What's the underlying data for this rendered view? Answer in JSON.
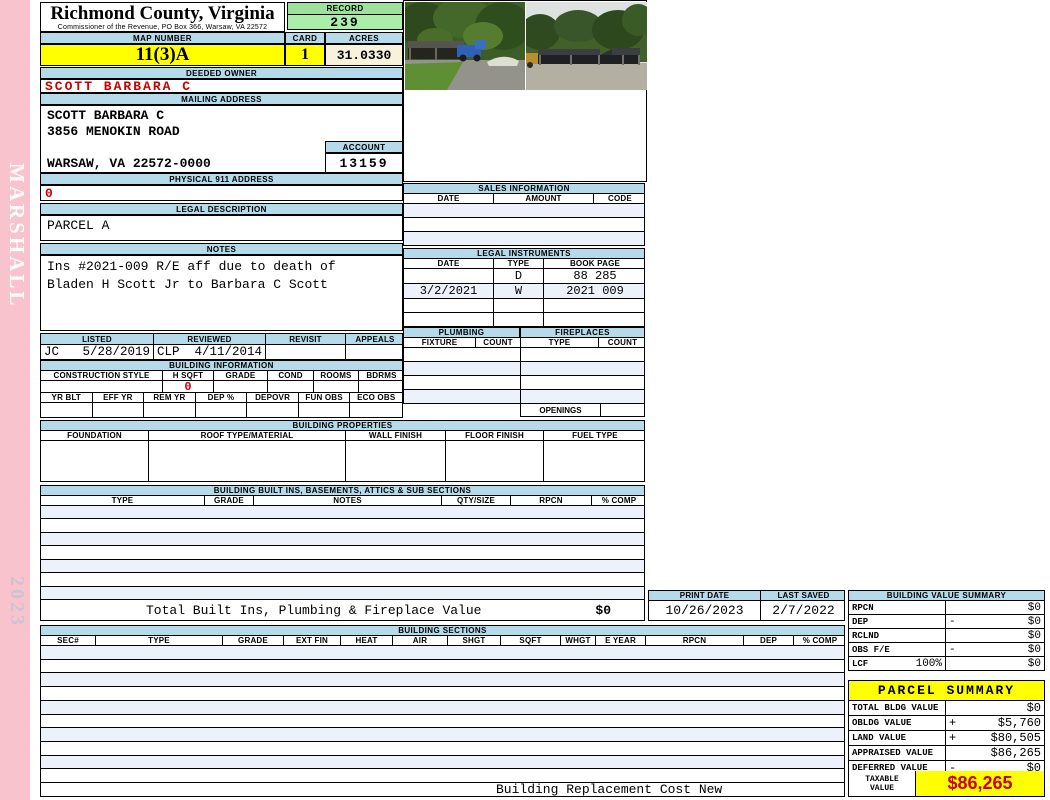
{
  "side": {
    "vendor": "MARSHALL",
    "year": "2023"
  },
  "header": {
    "county": "Richmond County, Virginia",
    "subtitle": "Commissioner of the Revenue, PO Box 366, Warsaw, VA 22572",
    "record_label": "RECORD",
    "record": "239",
    "map_number_label": "MAP NUMBER",
    "map_number": "11(3)A",
    "card_label": "CARD",
    "card": "1",
    "acres_label": "ACRES",
    "acres": "31.0330"
  },
  "owner": {
    "label": "DEEDED OWNER",
    "name": "SCOTT BARBARA C"
  },
  "mailing": {
    "label": "MAILING ADDRESS",
    "lines": [
      "SCOTT BARBARA C",
      "3856 MENOKIN ROAD",
      "",
      "WARSAW, VA 22572-0000"
    ],
    "account_label": "ACCOUNT",
    "account": "13159"
  },
  "physical911": {
    "label": "PHYSICAL 911 ADDRESS",
    "value": "0"
  },
  "legal_description": {
    "label": "LEGAL DESCRIPTION",
    "value": "PARCEL A"
  },
  "notes": {
    "label": "NOTES",
    "lines": [
      "Ins #2021-009 R/E aff due to death of",
      "Bladen H Scott Jr to Barbara C Scott"
    ]
  },
  "review": {
    "labels": [
      "LISTED",
      "REVIEWED",
      "REVISIT",
      "APPEALS"
    ],
    "listed_by": "JC",
    "listed_date": "5/28/2019",
    "reviewed_by": "CLP",
    "reviewed_date": "4/11/2014",
    "revisit": "",
    "appeals": ""
  },
  "building_information": {
    "label": "BUILDING INFORMATION",
    "headers_row1": [
      "CONSTRUCTION STYLE",
      "H SQFT",
      "GRADE",
      "COND",
      "ROOMS",
      "BDRMS"
    ],
    "h_sqft": "0",
    "headers_row2": [
      "YR BLT",
      "EFF YR",
      "REM YR",
      "DEP %",
      "DEPOVR",
      "FUN OBS",
      "ECO OBS"
    ]
  },
  "building_properties": {
    "label": "BUILDING PROPERTIES",
    "headers": [
      "FOUNDATION",
      "ROOF TYPE/MATERIAL",
      "WALL FINISH",
      "FLOOR FINISH",
      "FUEL TYPE"
    ]
  },
  "built_ins": {
    "label": "BUILDING BUILT INS, BASEMENTS, ATTICS & SUB SECTIONS",
    "headers": [
      "TYPE",
      "GRADE",
      "NOTES",
      "QTY/SIZE",
      "RPCN",
      "% COMP"
    ],
    "total_label": "Total Built Ins, Plumbing & Fireplace Value",
    "total_value": "$0"
  },
  "sales_information": {
    "label": "SALES INFORMATION",
    "headers": [
      "DATE",
      "AMOUNT",
      "CODE"
    ]
  },
  "legal_instruments": {
    "label": "LEGAL INSTRUMENTS",
    "headers": [
      "DATE",
      "TYPE",
      "BOOK PAGE"
    ],
    "rows": [
      [
        "",
        "D",
        "88 285"
      ],
      [
        "3/2/2021",
        "W",
        "2021 009"
      ],
      [
        "",
        "",
        ""
      ],
      [
        "",
        "",
        ""
      ]
    ]
  },
  "plumbing": {
    "label": "PLUMBING",
    "headers": [
      "FIXTURE",
      "COUNT"
    ]
  },
  "fireplaces": {
    "label": "FIREPLACES",
    "headers": [
      "TYPE",
      "COUNT"
    ],
    "openings_label": "OPENINGS"
  },
  "print_info": {
    "print_date_label": "PRINT DATE",
    "print_date": "10/26/2023",
    "last_saved_label": "LAST SAVED",
    "last_saved": "2/7/2022"
  },
  "building_value_summary": {
    "label": "BUILDING VALUE SUMMARY",
    "rows": [
      {
        "label": "RPCN",
        "sign": "",
        "value": "$0"
      },
      {
        "label": "DEP",
        "sign": "-",
        "value": "$0"
      },
      {
        "label": "RCLND",
        "sign": "",
        "value": "$0"
      },
      {
        "label": "OBS F/E",
        "sign": "-",
        "value": "$0"
      },
      {
        "label": "LCF",
        "pct": "100%",
        "sign": "",
        "value": "$0"
      }
    ]
  },
  "building_sections": {
    "label": "BUILDING SECTIONS",
    "headers": [
      "SEC#",
      "TYPE",
      "GRADE",
      "EXT FIN",
      "HEAT",
      "AIR",
      "SHGT",
      "SQFT",
      "WHGT",
      "E YEAR",
      "RPCN",
      "DEP",
      "% COMP"
    ],
    "footer": "Building Replacement Cost New"
  },
  "parcel_summary": {
    "label": "PARCEL SUMMARY",
    "rows": [
      {
        "label": "TOTAL BLDG VALUE",
        "sign": "",
        "value": "$0"
      },
      {
        "label": "OBLDG VALUE",
        "sign": "+",
        "value": "$5,760"
      },
      {
        "label": "LAND VALUE",
        "sign": "+",
        "value": "$80,505"
      },
      {
        "label": "APPRAISED VALUE",
        "sign": "",
        "value": "$86,265"
      },
      {
        "label": "DEFERRED VALUE",
        "sign": "-",
        "value": "$0"
      }
    ],
    "taxable_label_line1": "TAXABLE",
    "taxable_label_line2": "VALUE",
    "taxable_value": "$86,265"
  },
  "colors": {
    "sidebar_pink": "#F9C3CE",
    "header_blue": "#B5DAE9",
    "record_green": "#A9EFA9",
    "accent_yellow": "#FFFF00",
    "acres_cream": "#F8F1DC",
    "value_red": "#CC0000",
    "row_stripe": "#EDF1F9"
  }
}
